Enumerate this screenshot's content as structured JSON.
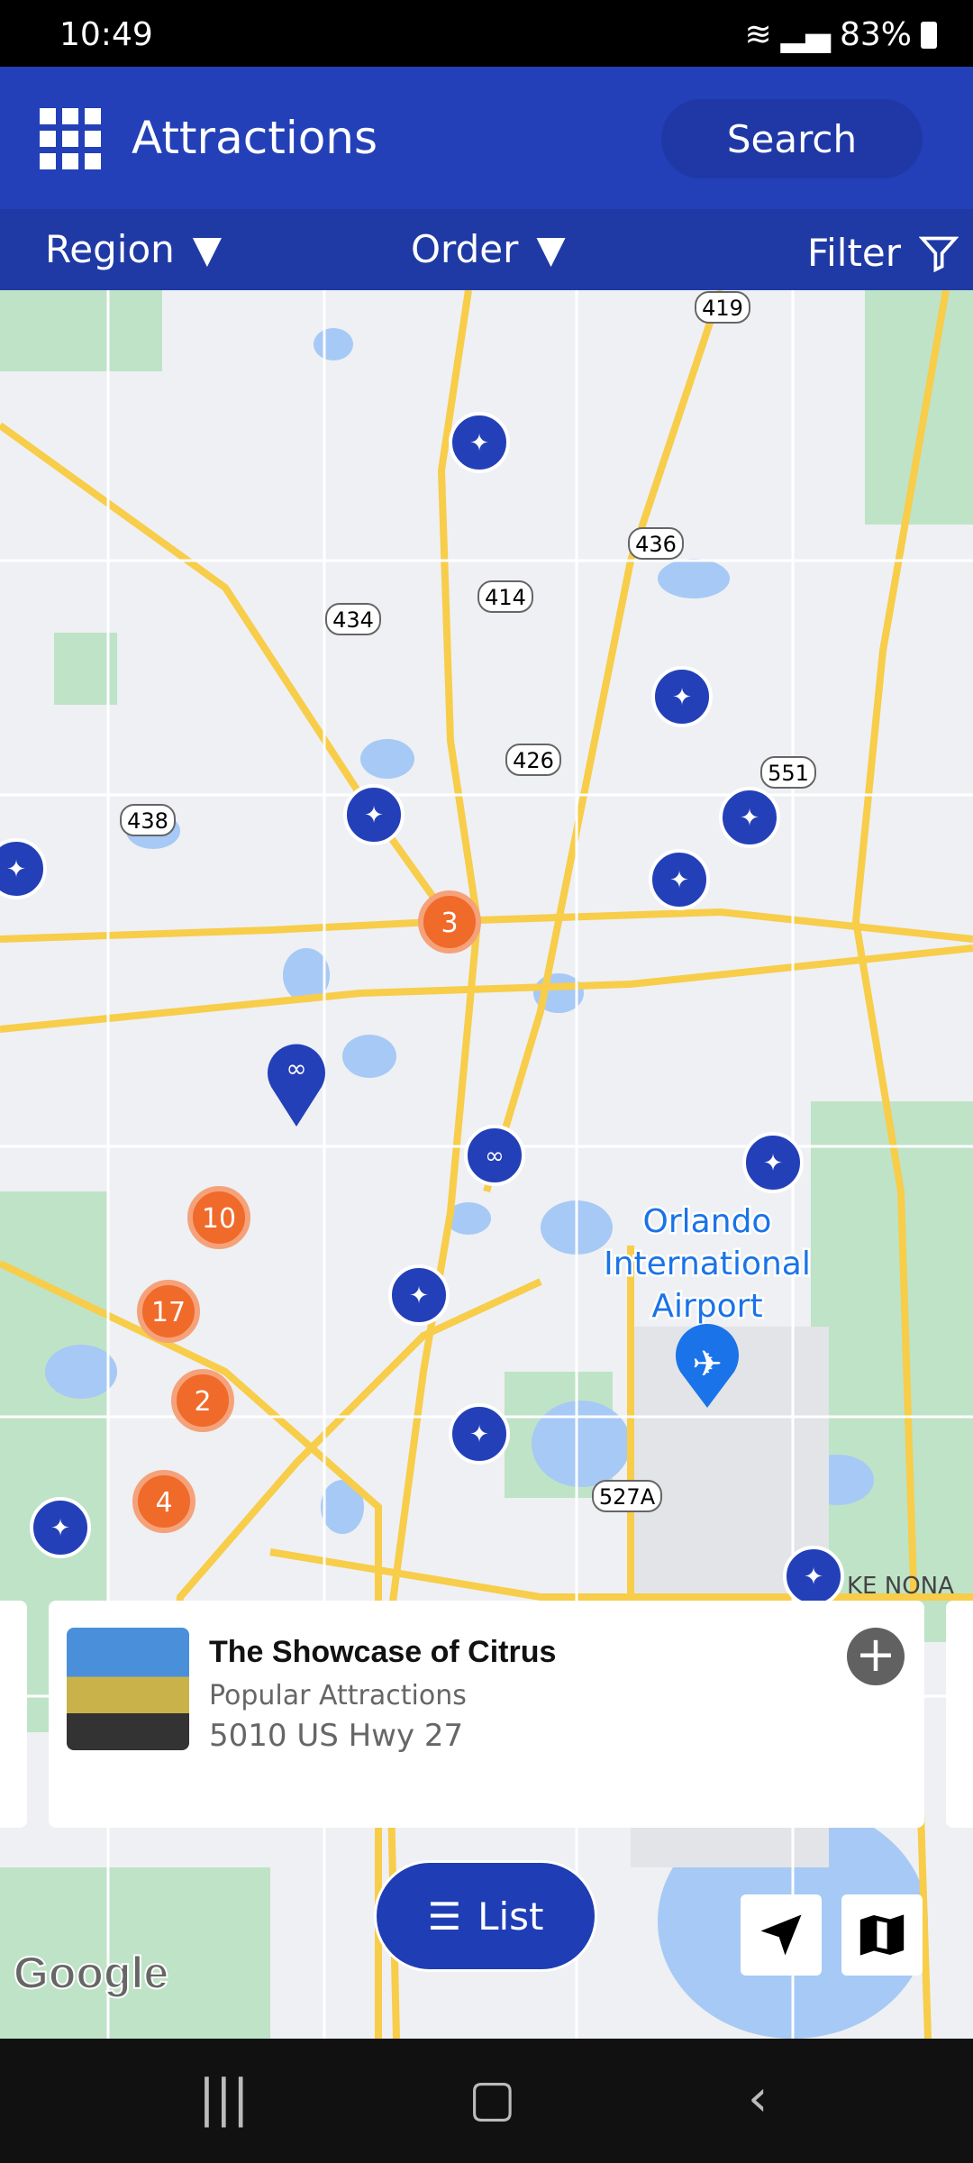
{
  "status_bar": {
    "time": "10:49",
    "battery": "83%"
  },
  "header": {
    "title": "Attractions",
    "search_label": "Search"
  },
  "filter_bar": {
    "region": "Region",
    "order": "Order",
    "filter": "Filter"
  },
  "map": {
    "road_labels": [
      "419",
      "436",
      "414",
      "434",
      "426",
      "551",
      "438",
      "527A"
    ],
    "place_labels": {
      "airport": [
        "Orlando",
        "International",
        "Airport"
      ],
      "lake_nona": "KE NONA"
    },
    "clusters": [
      "3",
      "10",
      "17",
      "2",
      "4"
    ],
    "brand": "Google",
    "colors": {
      "marker_blue": "#2340b8",
      "cluster_orange": "#f06a2a",
      "water": "#a7c9f5",
      "park": "#bfe3c7",
      "road": "#f7cd4a"
    }
  },
  "card": {
    "title": "The Showcase of Citrus",
    "category": "Popular Attractions",
    "address": "5010 US Hwy 27"
  },
  "list_button": {
    "label": "List"
  }
}
